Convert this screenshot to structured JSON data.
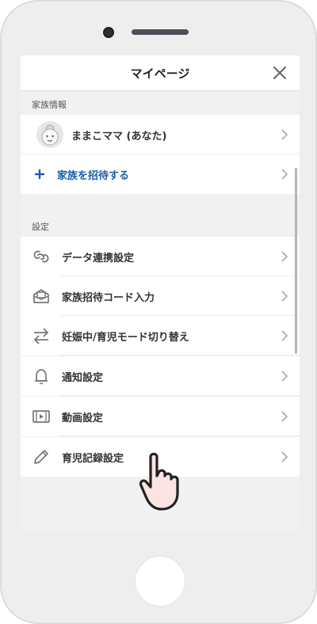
{
  "header": {
    "title": "マイページ"
  },
  "sections": {
    "family": "家族情報",
    "settings": "設定"
  },
  "family_rows": {
    "user": {
      "label": "ままこママ (あなた)",
      "icon": "avatar-icon"
    },
    "invite": {
      "label": "家族を招待する",
      "icon": "plus-icon",
      "color": "#1a5da8"
    }
  },
  "settings_rows": [
    {
      "label": "データ連携設定",
      "icon": "link-icon"
    },
    {
      "label": "家族招待コード入力",
      "icon": "envelope-icon"
    },
    {
      "label": "妊娠中/育児モード切り替え",
      "icon": "swap-icon"
    },
    {
      "label": "通知設定",
      "icon": "bell-icon"
    },
    {
      "label": "動画設定",
      "icon": "video-icon"
    },
    {
      "label": "育児記録設定",
      "icon": "pencil-icon"
    }
  ]
}
